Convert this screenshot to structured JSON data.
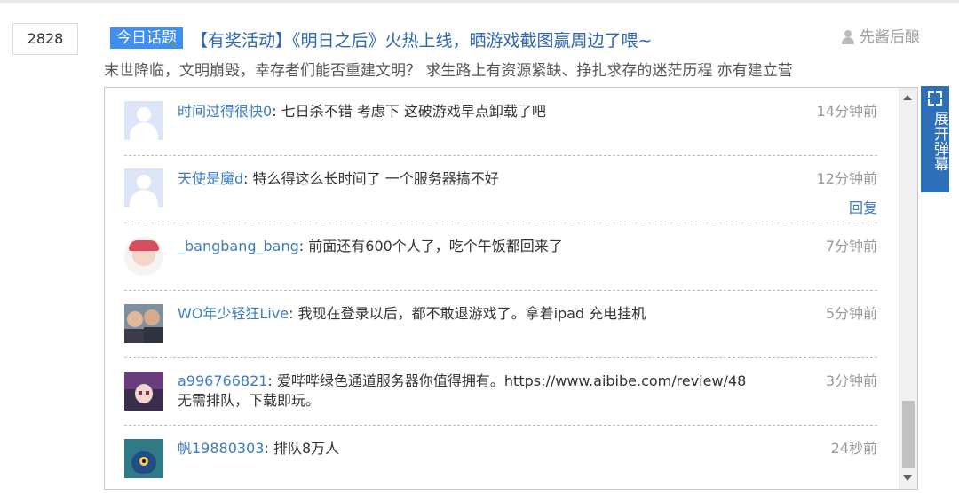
{
  "topic": {
    "count": "2828",
    "badge": "今日话题",
    "headline": "【有奖活动】《明日之后》火热上线，晒游戏截图赢周边了喂~",
    "author": "先酱后酿",
    "description": "末世降临，文明崩毁，幸存者们能否重建文明？ 求生路上有资源紧缺、挣扎求存的迷茫历程 亦有建立营"
  },
  "expand_button": {
    "label": "展开弹幕",
    "icon": "expand-icon"
  },
  "comments": [
    {
      "user": "时间过得很快0",
      "separator": ": ",
      "text": "七日杀不错 考虑下 这破游戏早点卸载了吧",
      "time": "14分钟前",
      "avatar": "default-avatar"
    },
    {
      "user": "天使是魔d",
      "separator": ": ",
      "text": "特么得这么长时间了 一个服务器搞不好",
      "time": "12分钟前",
      "reply": "回复",
      "avatar": "default-avatar"
    },
    {
      "user": "_bangbang_bang",
      "separator": ": ",
      "text": "前面还有600个人了，吃个午饭都回来了",
      "time": "7分钟前",
      "avatar": "baby-avatar"
    },
    {
      "user": "WO年少轻狂Live",
      "separator": ": ",
      "text": "我现在登录以后，都不敢退游戏了。拿着ipad 充电挂机",
      "time": "5分钟前",
      "avatar": "couple-avatar"
    },
    {
      "user": "a996766821",
      "separator": ": ",
      "text": "爱哔哔绿色通道服务器你值得拥有。https://www.aibibe.com/review/48",
      "text2": "无需排队，下载即玩。",
      "time": "3分钟前",
      "avatar": "anime-avatar"
    },
    {
      "user": "帆19880303",
      "separator": ": ",
      "text": "排队8万人",
      "time": "24秒前",
      "avatar": "monster-avatar"
    }
  ]
}
